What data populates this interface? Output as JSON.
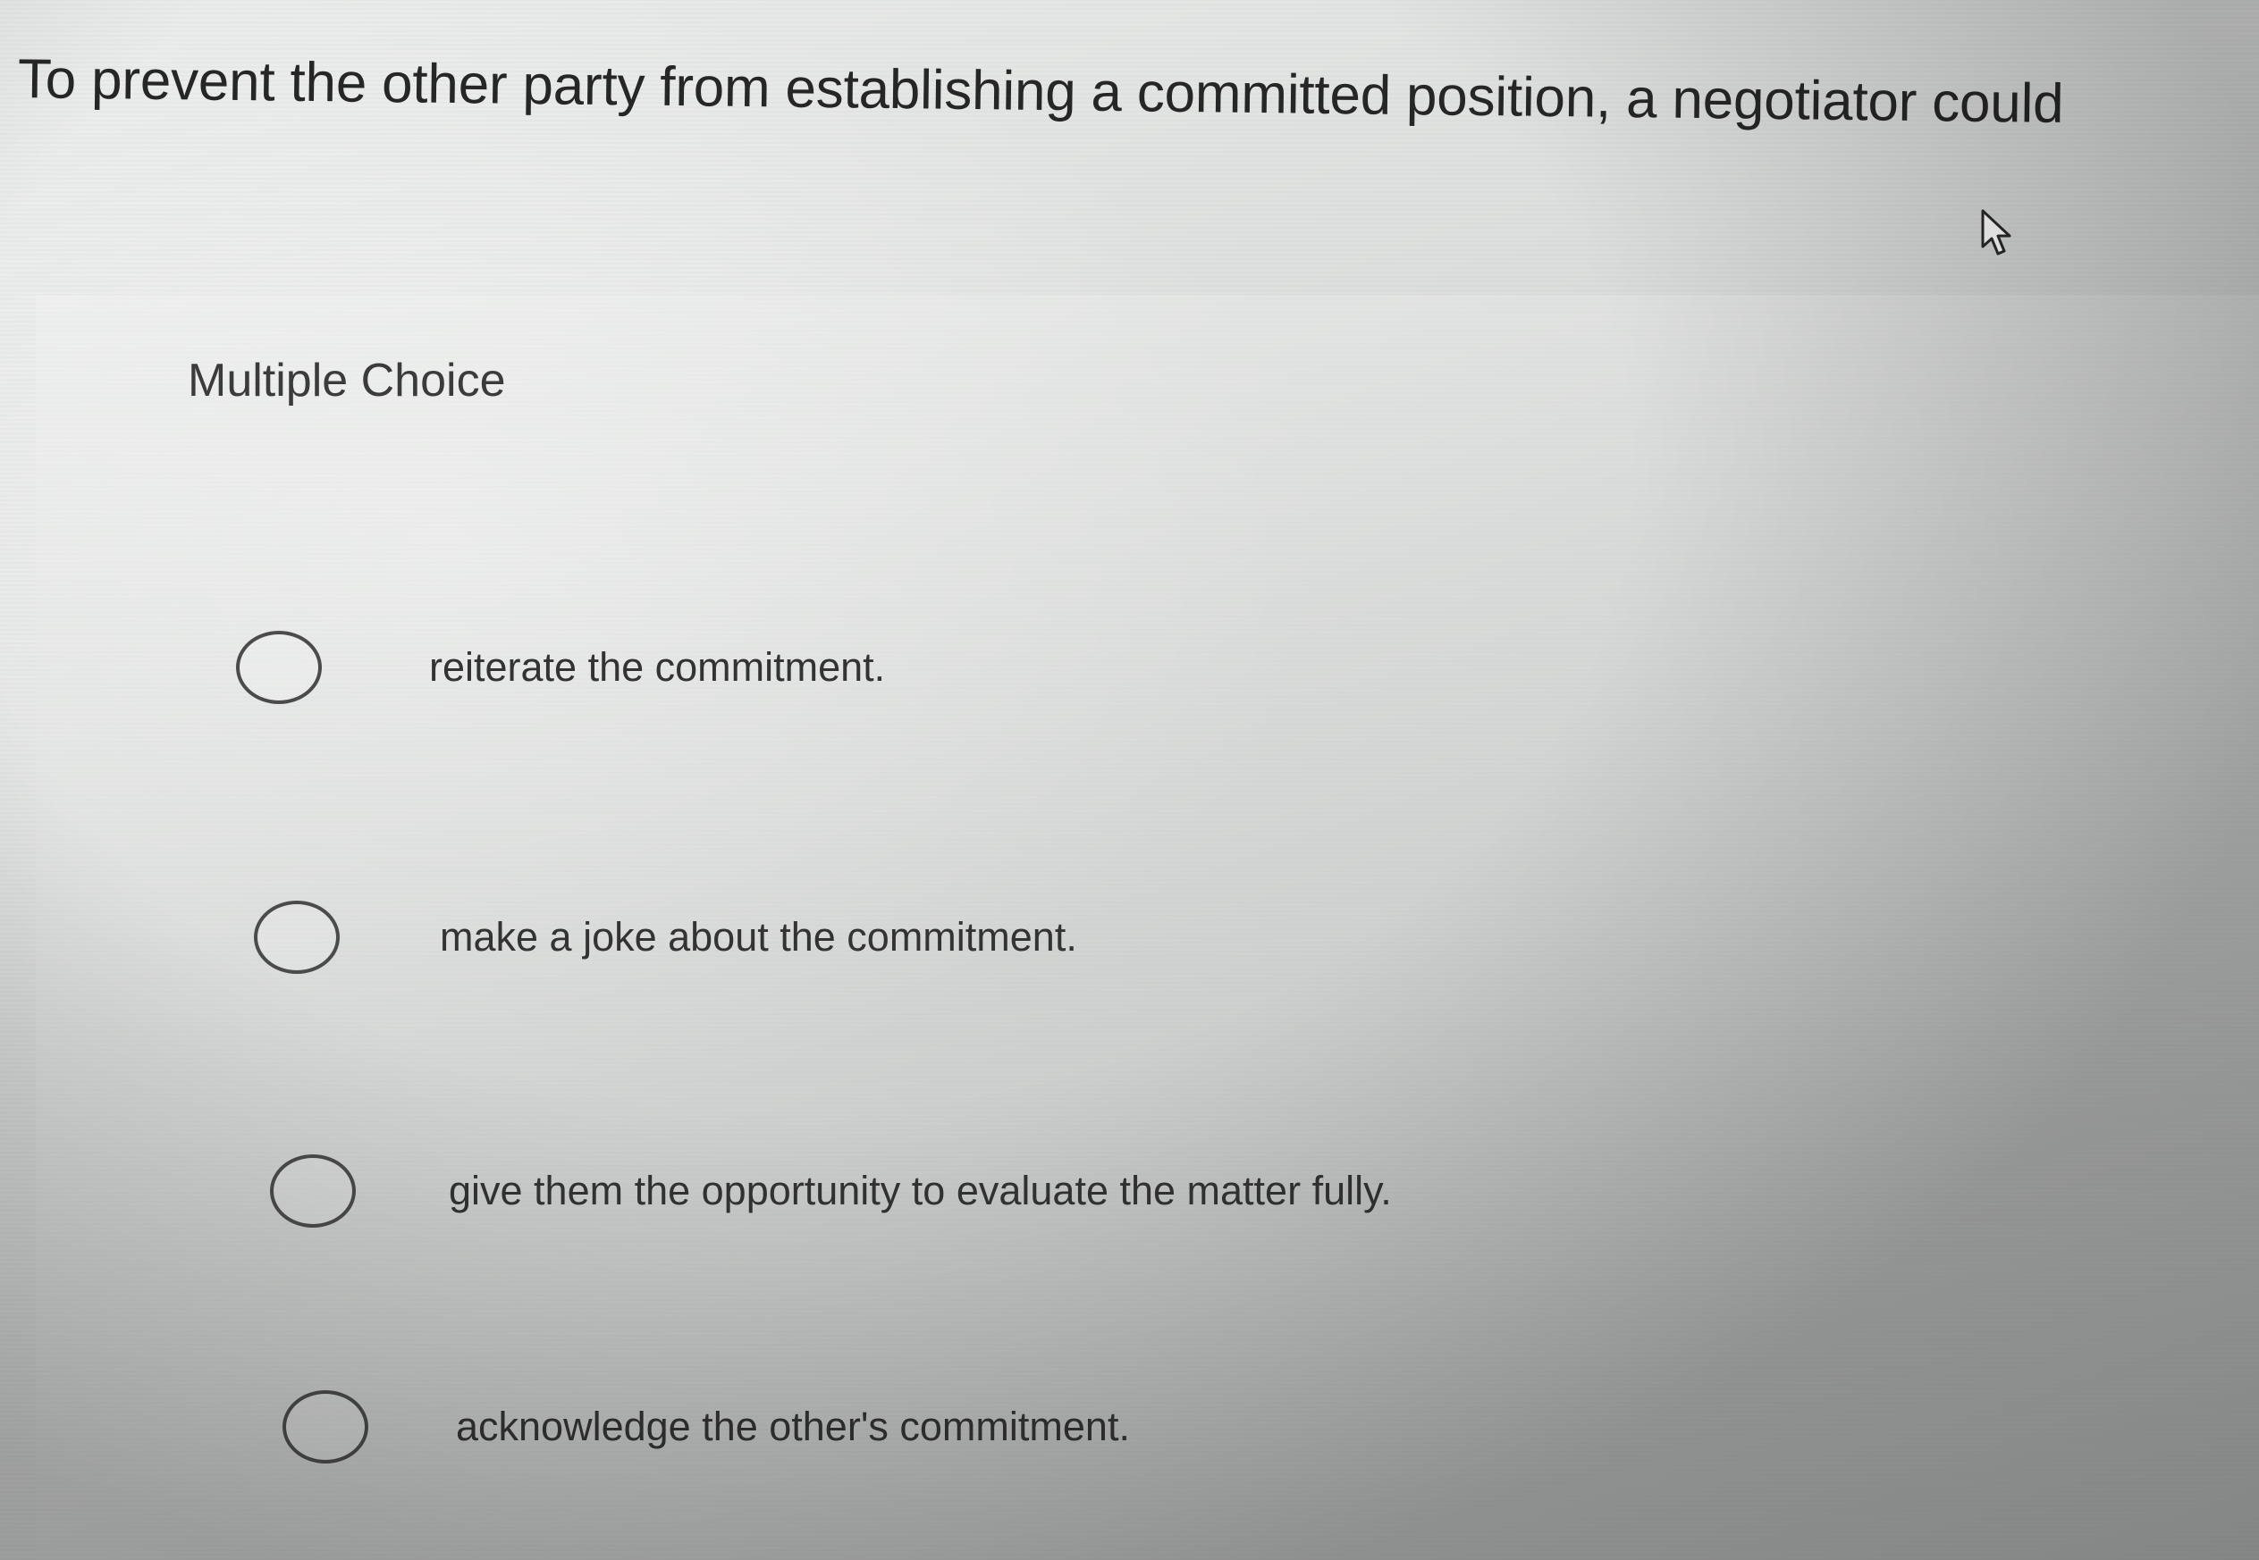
{
  "question": {
    "text": "To prevent the other party from establishing a committed position, a negotiator could"
  },
  "section": {
    "label": "Multiple Choice"
  },
  "options": [
    {
      "label": "reiterate the commitment.",
      "selected": false
    },
    {
      "label": "make a joke about the commitment.",
      "selected": false
    },
    {
      "label": "give them the opportunity to evaluate the matter fully.",
      "selected": false
    },
    {
      "label": "acknowledge the other's commitment.",
      "selected": false
    }
  ],
  "cursor": {
    "icon": "pointer-cursor-icon"
  },
  "colors": {
    "text": "#262626",
    "radio_border": "#4b4b4b",
    "background": "#dcdedd"
  }
}
